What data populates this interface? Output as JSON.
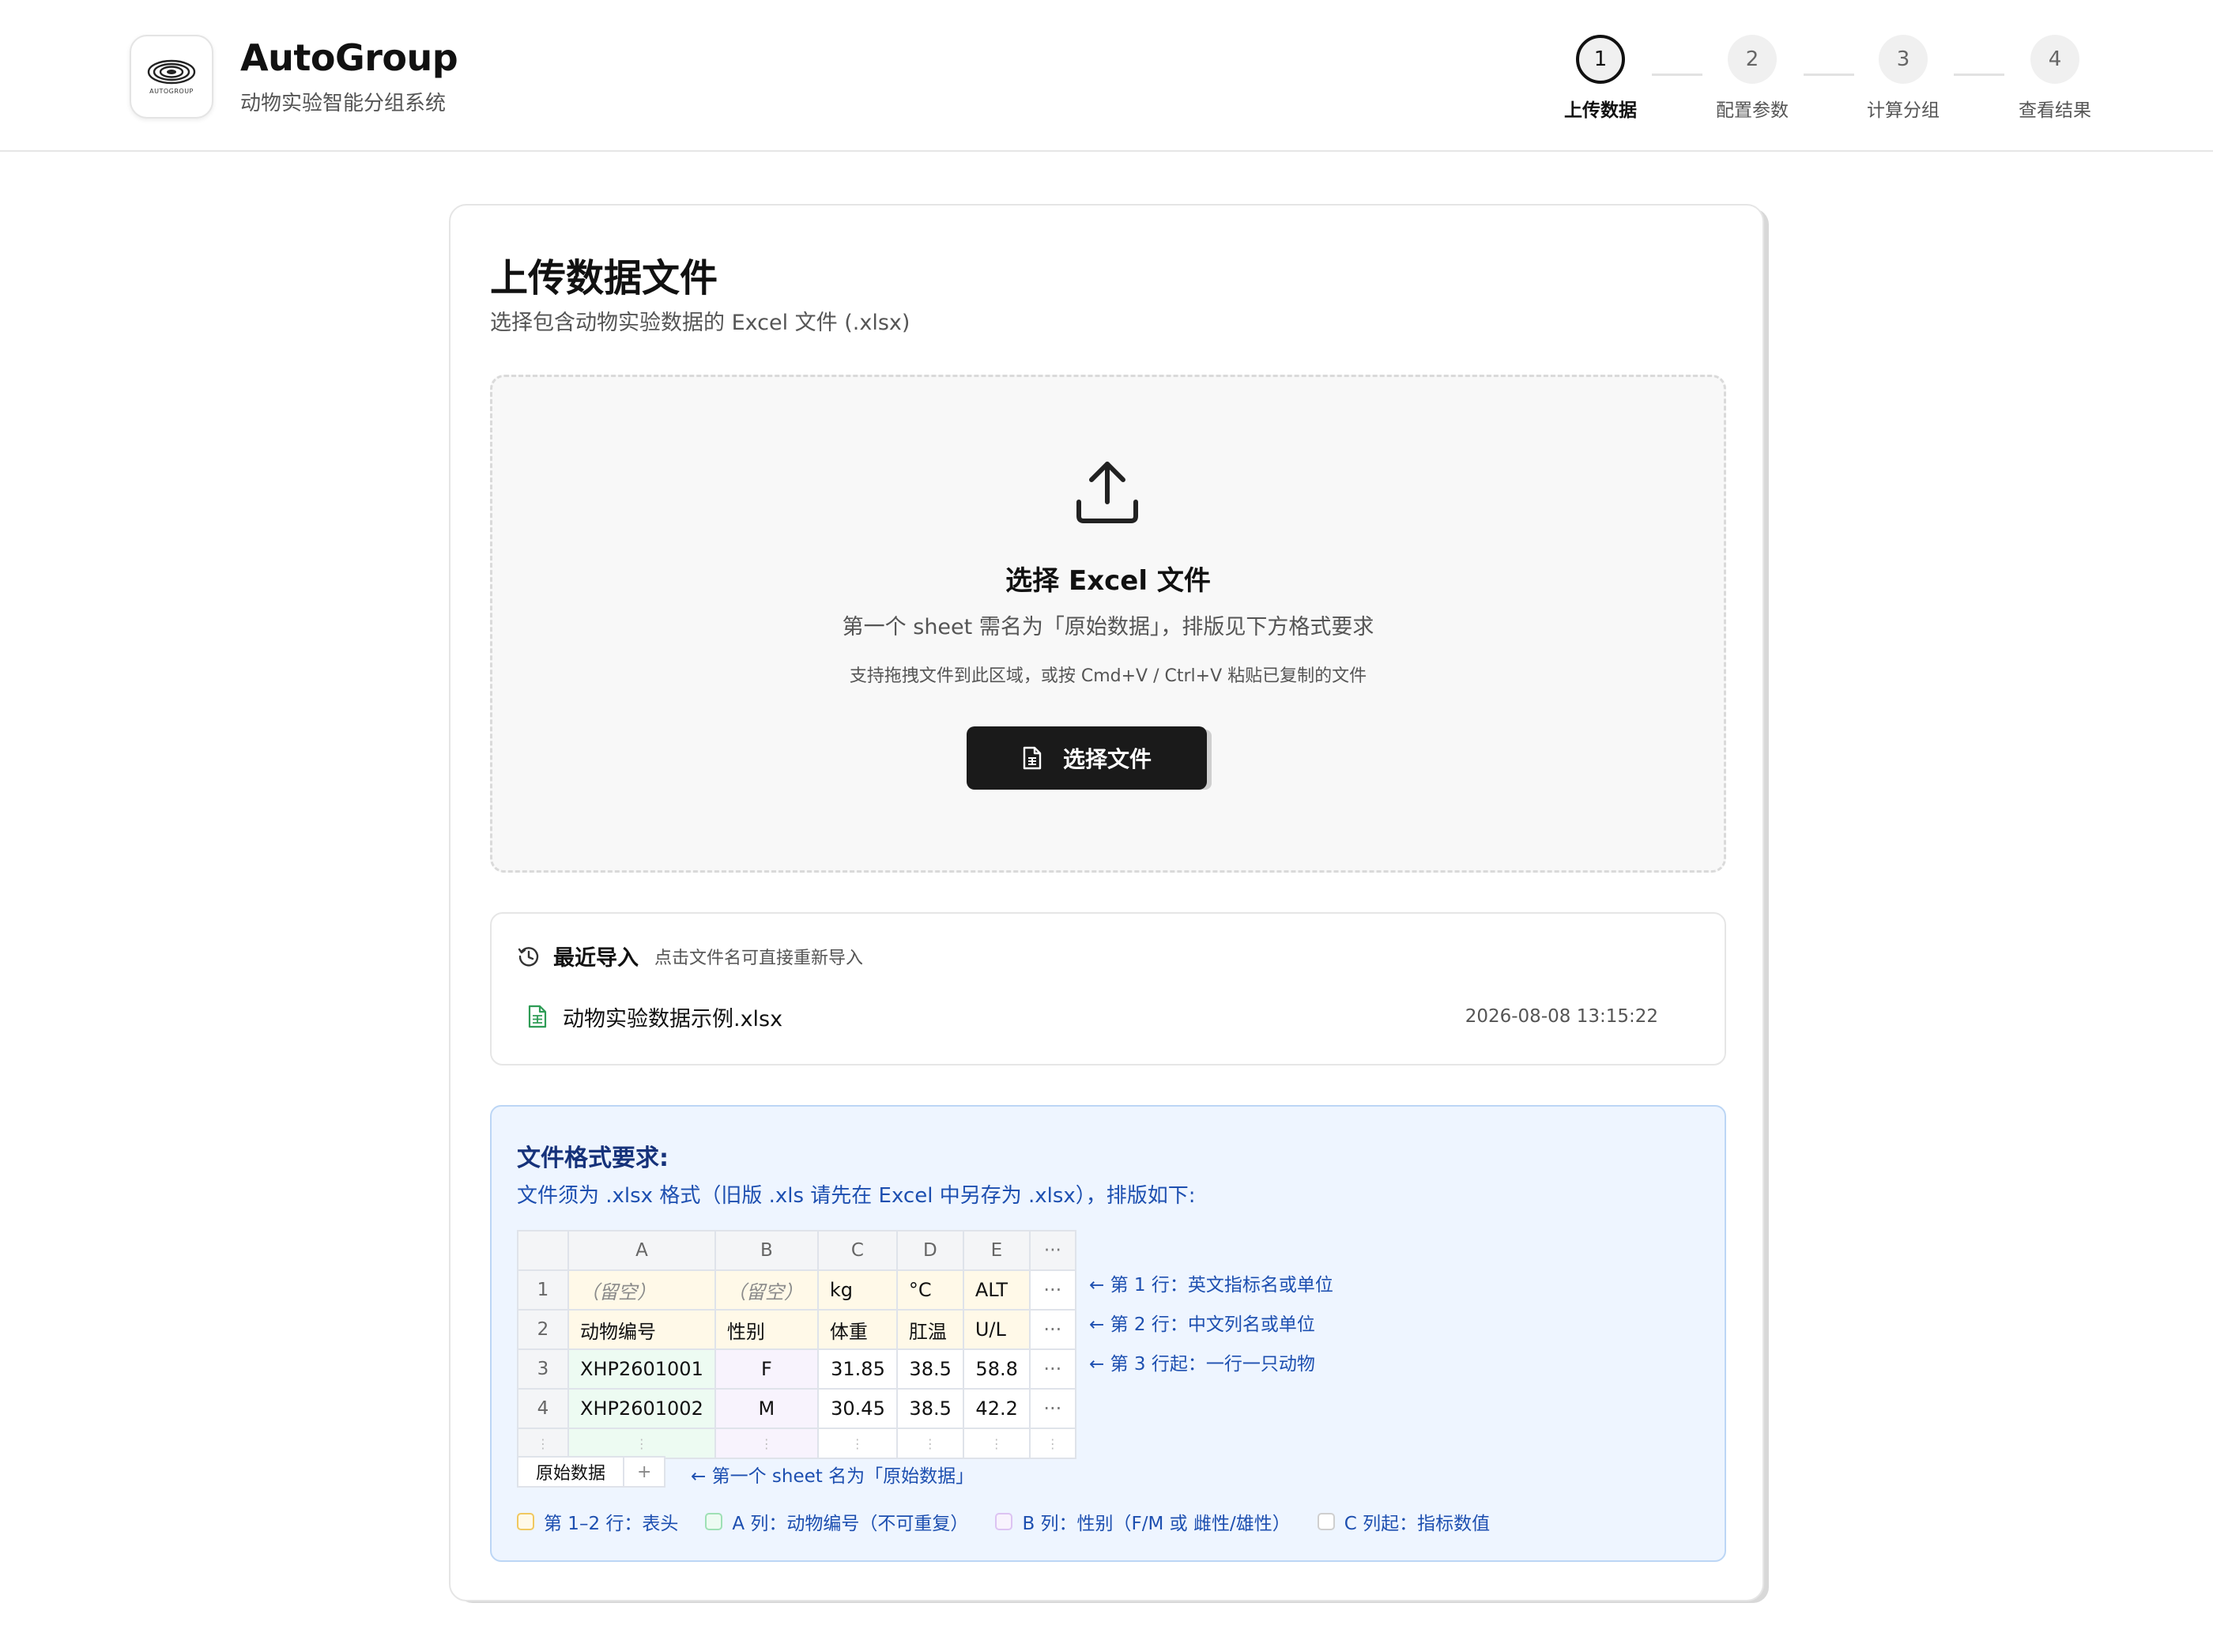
{
  "app": {
    "name": "AutoGroup",
    "subtitle": "动物实验智能分组系统",
    "logo_text": "AUTOGROUP"
  },
  "steps": [
    {
      "number": "1",
      "label": "上传数据",
      "active": true
    },
    {
      "number": "2",
      "label": "配置参数",
      "active": false
    },
    {
      "number": "3",
      "label": "计算分组",
      "active": false
    },
    {
      "number": "4",
      "label": "查看结果",
      "active": false
    }
  ],
  "upload": {
    "title": "上传数据文件",
    "subtitle": "选择包含动物实验数据的 Excel 文件 (.xlsx)",
    "dropzone": {
      "icon": "upload-icon",
      "title": "选择 Excel 文件",
      "description": "第一个 sheet 需名为「原始数据」，排版见下方格式要求",
      "hint": "支持拖拽文件到此区域，或按 Cmd+V / Ctrl+V 粘贴已复制的文件",
      "button_label": "选择文件",
      "button_icon": "file-icon"
    }
  },
  "recent": {
    "icon": "history-icon",
    "title": "最近导入",
    "tip": "点击文件名可直接重新导入",
    "items": [
      {
        "icon": "spreadsheet-icon",
        "name": "动物实验数据示例.xlsx",
        "time": "2026-08-08 13:15:22"
      }
    ]
  },
  "format": {
    "title": "文件格式要求:",
    "description": "文件须为 .xlsx 格式（旧版 .xls 请先在 Excel 中另存为 .xlsx），排版如下:",
    "columns": [
      "",
      "A",
      "B",
      "C",
      "D",
      "E",
      "···"
    ],
    "rows": [
      {
        "num": "1",
        "cells": [
          "（留空）",
          "（留空）",
          "kg",
          "°C",
          "ALT",
          "···"
        ],
        "note": "← 第 1 行：英文指标名或单位"
      },
      {
        "num": "2",
        "cells": [
          "动物编号",
          "性别",
          "体重",
          "肛温",
          "U/L",
          "···"
        ],
        "note": "← 第 2 行：中文列名或单位"
      },
      {
        "num": "3",
        "cells": [
          "XHP2601001",
          "F",
          "31.85",
          "38.5",
          "58.8",
          "···"
        ],
        "note": "← 第 3 行起：一行一只动物"
      },
      {
        "num": "4",
        "cells": [
          "XHP2601002",
          "M",
          "30.45",
          "38.5",
          "42.2",
          "···"
        ],
        "note": ""
      }
    ],
    "continuation": "⋮",
    "sheet_tab": "原始数据",
    "sheet_tab_add": "+",
    "sheet_note": "← 第一个 sheet 名为「原始数据」",
    "legend": [
      {
        "label": "第 1–2 行：表头",
        "border": "#f0c860",
        "fill": "#fff9e8"
      },
      {
        "label": "A 列：动物编号（不可重复）",
        "border": "#9ee0b5",
        "fill": "#edfbf2"
      },
      {
        "label": "B 列：性别（F/M 或 雌性/雄性）",
        "border": "#dcc3f2",
        "fill": "#f8f3fd"
      },
      {
        "label": "C 列起：指标数值",
        "border": "#cfcfcf",
        "fill": "#ffffff"
      }
    ]
  },
  "colors": {
    "accent": "#111111",
    "info_text": "#1d4fb0",
    "info_bg": "#eef5ff",
    "info_border": "#bcd6f5"
  }
}
